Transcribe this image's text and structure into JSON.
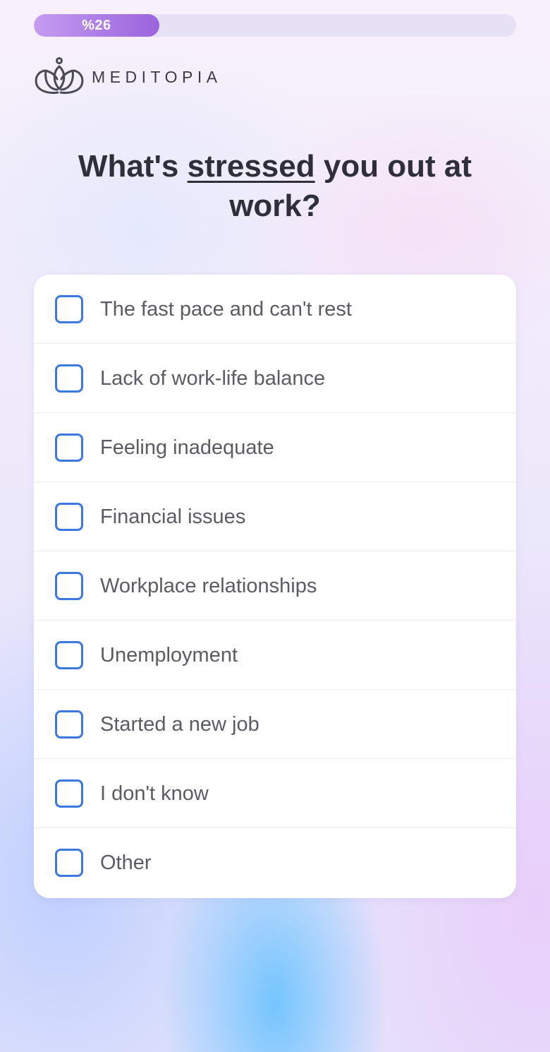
{
  "progress": {
    "label": "%26",
    "percent": 26,
    "fill_color": "#9a63dc"
  },
  "brand": {
    "name": "MEDITOPIA",
    "icon": "lotus-icon"
  },
  "question": {
    "before": "What's ",
    "emphasis": "stressed",
    "after": " you out at work?"
  },
  "options": [
    {
      "label": "The fast pace and can't rest",
      "checked": false
    },
    {
      "label": "Lack of work-life balance",
      "checked": false
    },
    {
      "label": "Feeling inadequate",
      "checked": false
    },
    {
      "label": "Financial issues",
      "checked": false
    },
    {
      "label": "Workplace relationships",
      "checked": false
    },
    {
      "label": "Unemployment",
      "checked": false
    },
    {
      "label": "Started a new job",
      "checked": false
    },
    {
      "label": "I don't know",
      "checked": false
    },
    {
      "label": "Other",
      "checked": false
    }
  ],
  "colors": {
    "checkbox_border": "#3b78e0",
    "text": "#2f2f39"
  }
}
